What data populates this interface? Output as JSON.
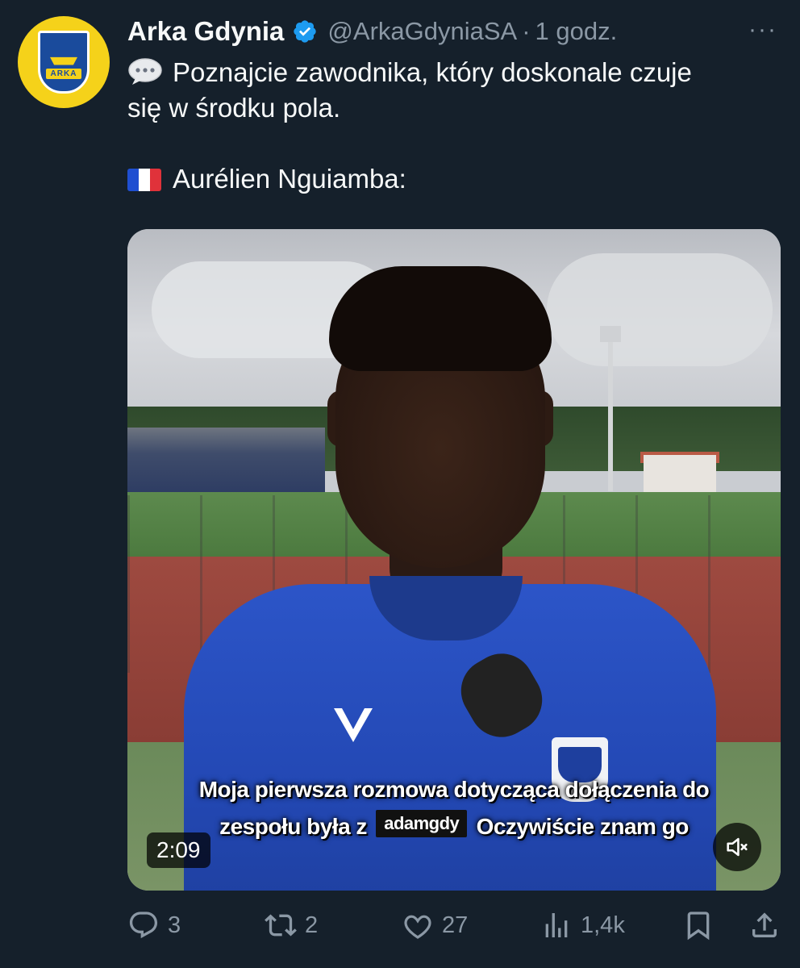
{
  "author": {
    "name": "Arka Gdynia",
    "handle": "@ArkaGdyniaSA",
    "separator": "·",
    "time": "1 godz.",
    "verified_color": "#1d9bf0",
    "avatar_bg": "#f5d21a",
    "avatar_text": "ARKA",
    "avatar_icon": "arka-crest-icon"
  },
  "more_label": "···",
  "text": {
    "line1": "Poznajcie zawodnika, który doskonale czuje",
    "line2": "się w środku pola.",
    "line3": "Aurélien Nguiamba:",
    "line1_icon": "speech-bubble-icon",
    "line3_icon": "france-flag-icon"
  },
  "video": {
    "subtitle_line1": "Moja pierwsza rozmowa dotycząca dołączenia do",
    "subtitle_line2_start": "zespołu była z",
    "subtitle_tag": "adamgdy",
    "subtitle_line2_end": "Oczywiście znam go",
    "duration": "2:09",
    "mute_icon": "speaker-muted-icon"
  },
  "actions": {
    "replies": "3",
    "retweets": "2",
    "likes": "27",
    "views": "1,4k"
  },
  "colors": {
    "background": "#15202b",
    "text": "#f7f9f9",
    "secondary": "#8b98a5"
  }
}
